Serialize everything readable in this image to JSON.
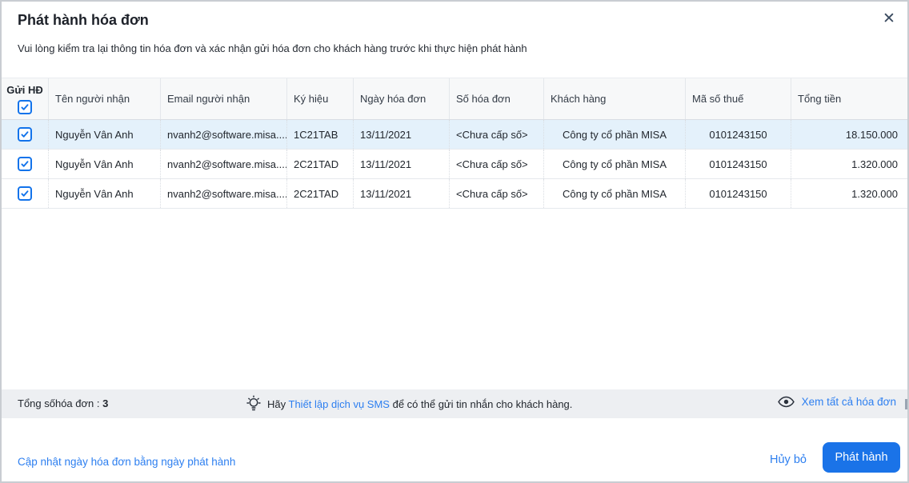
{
  "dialog": {
    "title": "Phát hành hóa đơn",
    "subtitle": "Vui lòng kiểm tra lại thông tin hóa đơn và xác nhận gửi hóa đơn cho khách hàng trước khi thực hiện phát hành",
    "close_icon": "✕"
  },
  "table": {
    "columns": [
      "Gửi HĐ",
      "Tên người nhận",
      "Email người nhận",
      "Ký hiệu",
      "Ngày hóa đơn",
      "Số hóa đơn",
      "Khách hàng",
      "Mã số thuế",
      "Tổng tiền"
    ],
    "header_checkbox_checked": true,
    "rows": [
      {
        "selected": true,
        "checked": true,
        "recipient": "Nguyễn Vân Anh",
        "email": "nvanh2@software.misa....",
        "symbol": "1C21TAB",
        "date": "13/11/2021",
        "number": "<Chưa cấp số>",
        "customer": "Công ty cổ phần MISA",
        "tax_code": "0101243150",
        "total": "18.150.000"
      },
      {
        "selected": false,
        "checked": true,
        "recipient": "Nguyễn Vân Anh",
        "email": "nvanh2@software.misa....",
        "symbol": "2C21TAD",
        "date": "13/11/2021",
        "number": "<Chưa cấp số>",
        "customer": "Công ty cổ phần MISA",
        "tax_code": "0101243150",
        "total": "1.320.000"
      },
      {
        "selected": false,
        "checked": true,
        "recipient": "Nguyễn Vân Anh",
        "email": "nvanh2@software.misa....",
        "symbol": "2C21TAD",
        "date": "13/11/2021",
        "number": "<Chưa cấp số>",
        "customer": "Công ty cổ phần MISA",
        "tax_code": "0101243150",
        "total": "1.320.000"
      }
    ]
  },
  "summary_bar": {
    "total_label": "Tổng sốhóa đơn :",
    "total_value": "3",
    "sms_hint_prefix": "Hãy",
    "sms_link_label": "Thiết lập dịch vụ SMS",
    "sms_hint_suffix": "để có thể gửi tin nhắn cho khách hàng.",
    "view_all_label": "Xem tất cả hóa đơn"
  },
  "footer": {
    "update_date_link_label": "Cập nhật ngày hóa đơn bằng ngày phát hành",
    "cancel_label": "Hủy bỏ",
    "submit_label": "Phát hành"
  },
  "colors": {
    "accent_blue": "#1a73e8",
    "link_blue": "#2d7ff0",
    "checkbox_blue": "#1273eb",
    "selected_row_bg": "#e4f1fb",
    "summary_bar_bg": "#edeff2",
    "header_bg": "#f7f8f9"
  }
}
